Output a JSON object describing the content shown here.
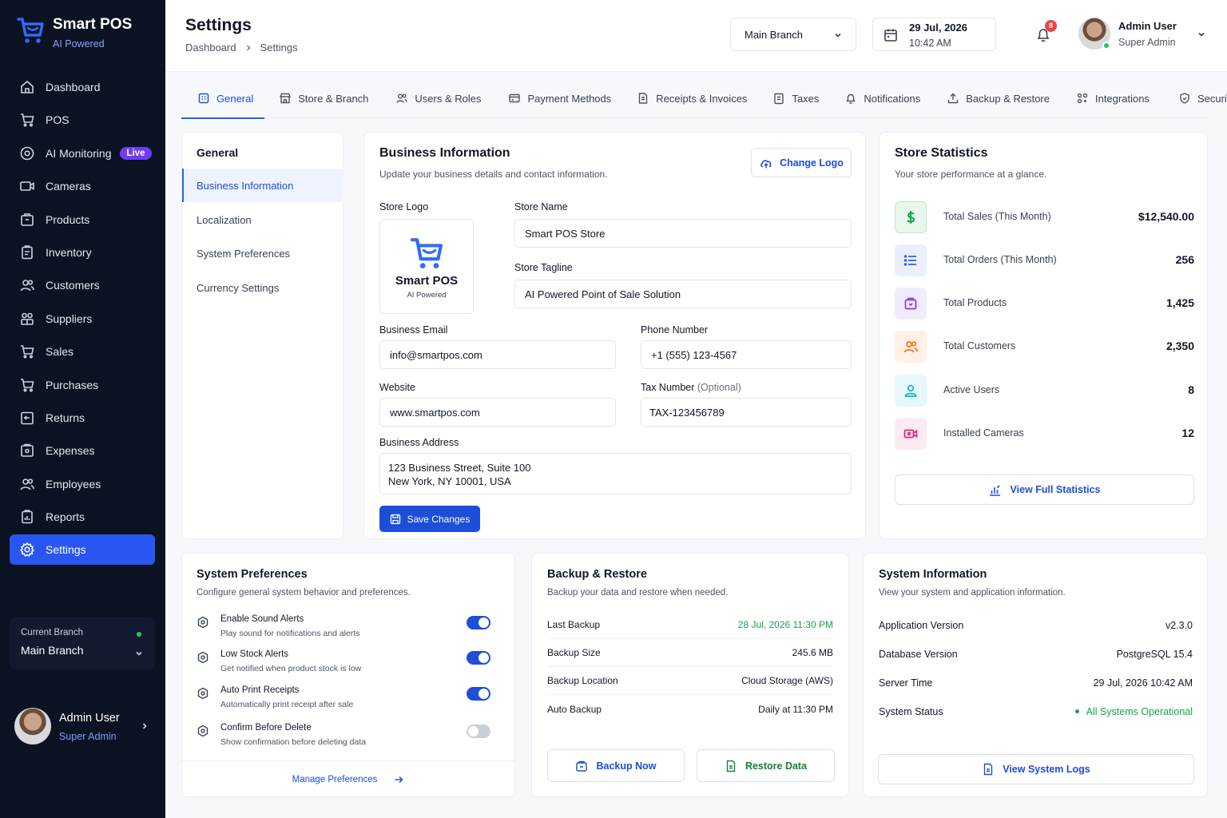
{
  "brand": {
    "name": "Smart POS",
    "tagline": "AI Powered"
  },
  "sidebar": {
    "items": [
      {
        "label": "Dashboard",
        "icon": "home-icon"
      },
      {
        "label": "POS",
        "icon": "cart-icon"
      },
      {
        "label": "AI Monitoring",
        "icon": "ai-monitor-icon",
        "badge": "Live"
      },
      {
        "label": "Cameras",
        "icon": "camera-icon"
      },
      {
        "label": "Products",
        "icon": "box-icon"
      },
      {
        "label": "Inventory",
        "icon": "clipboard-icon"
      },
      {
        "label": "Customers",
        "icon": "users-icon"
      },
      {
        "label": "Suppliers",
        "icon": "supplier-icon"
      },
      {
        "label": "Sales",
        "icon": "cart-icon"
      },
      {
        "label": "Purchases",
        "icon": "cart-icon"
      },
      {
        "label": "Returns",
        "icon": "return-icon"
      },
      {
        "label": "Expenses",
        "icon": "wallet-icon"
      },
      {
        "label": "Employees",
        "icon": "users-icon"
      },
      {
        "label": "Reports",
        "icon": "report-icon"
      },
      {
        "label": "Settings",
        "icon": "gear-icon",
        "active": true
      }
    ],
    "current_branch_label": "Current Branch",
    "current_branch_value": "Main Branch",
    "user": {
      "name": "Admin User",
      "role": "Super Admin"
    }
  },
  "header": {
    "title": "Settings",
    "breadcrumb": [
      "Dashboard",
      "Settings"
    ],
    "branch_select": "Main Branch",
    "date": "29 Jul, 2026",
    "time": "10:42 AM",
    "notification_count": "8",
    "user": {
      "name": "Admin User",
      "role": "Super Admin"
    }
  },
  "tabs": [
    {
      "label": "General",
      "icon": "building-icon",
      "active": true
    },
    {
      "label": "Store & Branch",
      "icon": "store-icon"
    },
    {
      "label": "Users & Roles",
      "icon": "users-icon"
    },
    {
      "label": "Payment Methods",
      "icon": "card-icon"
    },
    {
      "label": "Receipts & Invoices",
      "icon": "receipt-icon"
    },
    {
      "label": "Taxes",
      "icon": "tax-icon"
    },
    {
      "label": "Notifications",
      "icon": "bell-icon"
    },
    {
      "label": "Backup & Restore",
      "icon": "upload-icon"
    },
    {
      "label": "Integrations",
      "icon": "integrations-icon"
    },
    {
      "label": "Security",
      "icon": "shield-icon"
    }
  ],
  "subnav": {
    "title": "General",
    "items": [
      "Business Information",
      "Localization",
      "System Preferences",
      "Currency Settings"
    ]
  },
  "business": {
    "title": "Business Information",
    "subtitle": "Update your business details and contact information.",
    "change_logo": "Change Logo",
    "store_logo_label": "Store Logo",
    "logo_name": "Smart POS",
    "logo_tagline": "AI Powered",
    "store_name_label": "Store Name",
    "store_name": "Smart POS Store",
    "store_tagline_label": "Store Tagline",
    "store_tagline": "AI Powered Point of Sale Solution",
    "email_label": "Business Email",
    "email": "info@smartpos.com",
    "phone_label": "Phone Number",
    "phone": "+1 (555) 123-4567",
    "website_label": "Website",
    "website": "www.smartpos.com",
    "tax_label": "Tax Number",
    "tax_optional": "(Optional)",
    "tax": "TAX-123456789",
    "address_label": "Business Address",
    "address_line1": "123 Business Street, Suite 100",
    "address_line2": "New York, NY 10001, USA",
    "save": "Save Changes"
  },
  "stats": {
    "title": "Store Statistics",
    "subtitle": "Your store performance at a glance.",
    "rows": [
      {
        "label": "Total Sales (This Month)",
        "value": "$12,540.00",
        "color": "#16a34a",
        "bg": "#e8f8ee",
        "icon": "dollar-icon"
      },
      {
        "label": "Total Orders (This Month)",
        "value": "256",
        "color": "#2563eb",
        "bg": "#eaf0ff",
        "icon": "list-icon"
      },
      {
        "label": "Total Products",
        "value": "1,425",
        "color": "#7c3aed",
        "bg": "#f2ecff",
        "icon": "box-icon"
      },
      {
        "label": "Total Customers",
        "value": "2,350",
        "color": "#f97316",
        "bg": "#fff1e6",
        "icon": "users-icon"
      },
      {
        "label": "Active Users",
        "value": "8",
        "color": "#06b6d4",
        "bg": "#e6f8fb",
        "icon": "user-icon"
      },
      {
        "label": "Installed Cameras",
        "value": "12",
        "color": "#db2777",
        "bg": "#fdebf3",
        "icon": "camera-icon"
      }
    ],
    "view_full": "View Full Statistics"
  },
  "system_prefs": {
    "title": "System Preferences",
    "subtitle": "Configure general system behavior and preferences.",
    "items": [
      {
        "title": "Enable Sound Alerts",
        "desc": "Play sound for notifications and alerts",
        "on": true
      },
      {
        "title": "Low Stock Alerts",
        "desc": "Get notified when product stock is low",
        "on": true
      },
      {
        "title": "Auto Print Receipts",
        "desc": "Automatically print receipt after sale",
        "on": true
      },
      {
        "title": "Confirm Before Delete",
        "desc": "Show confirmation before deleting data",
        "on": false
      }
    ],
    "manage": "Manage Preferences"
  },
  "backup": {
    "title": "Backup & Restore",
    "subtitle": "Backup your data and restore when needed.",
    "rows": [
      {
        "k": "Last Backup",
        "v": "28 Jul, 2026 11:30 PM"
      },
      {
        "k": "Backup Size",
        "v": "245.6 MB"
      },
      {
        "k": "Backup Location",
        "v": "Cloud Storage (AWS)"
      },
      {
        "k": "Auto Backup",
        "v": "Daily at 11:30 PM"
      }
    ],
    "backup_now": "Backup Now",
    "restore": "Restore Data"
  },
  "sysinfo": {
    "title": "System Information",
    "subtitle": "View your system and application information.",
    "rows": [
      {
        "k": "Application Version",
        "v": "v2.3.0"
      },
      {
        "k": "Database Version",
        "v": "PostgreSQL 15.4"
      },
      {
        "k": "Server Time",
        "v": "29 Jul, 2026 10:42 AM"
      },
      {
        "k": "System Status",
        "v": "All Systems Operational"
      }
    ],
    "view_logs": "View System Logs"
  },
  "colors": {
    "primary": "#1d4ed8",
    "sidebar_bg": "#0b1222",
    "active_nav": "#2956f0",
    "success": "#16a34a"
  }
}
